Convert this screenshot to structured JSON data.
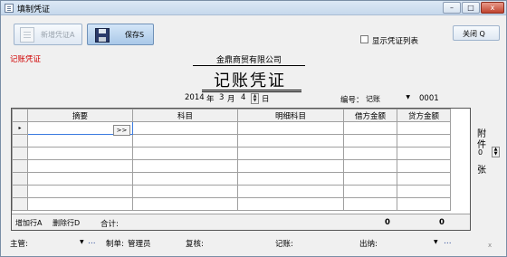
{
  "window": {
    "title": "填制凭证",
    "minimize": "–",
    "maximize": "□",
    "close": "x"
  },
  "toolbar": {
    "new_label": "新增凭证A",
    "save_label": "保存S",
    "close_label": "关闭 Q",
    "show_list_label": "显示凭证列表"
  },
  "voucher": {
    "type_label": "记账凭证",
    "company": "金鼎商贸有限公司",
    "title": "记账凭证",
    "year": "2014",
    "year_unit": "年",
    "month": "3",
    "month_unit": "月",
    "day": "4",
    "day_unit": "日",
    "number_label": "编号：",
    "number_type": "记账",
    "number": "0001"
  },
  "grid": {
    "columns": [
      "摘要",
      "科目",
      "明细科目",
      "借方金额",
      "贷方金额"
    ],
    "current_row_marker": "▸",
    "picker_label": ">>",
    "add_row_label": "增加行A",
    "delete_row_label": "删除行D",
    "total_label": "合计:",
    "total_debit": "0",
    "total_credit": "0"
  },
  "attachment": {
    "label_1": "附",
    "label_2": "件",
    "count": "0",
    "label_3": "张"
  },
  "signatures": {
    "supervisor_label": "主管:",
    "maker_label": "制单:",
    "maker_value": "管理员",
    "reviewer_label": "复核:",
    "bookkeeper_label": "记账:",
    "cashier_label": "出纳:",
    "more": "...",
    "corner": "x"
  }
}
